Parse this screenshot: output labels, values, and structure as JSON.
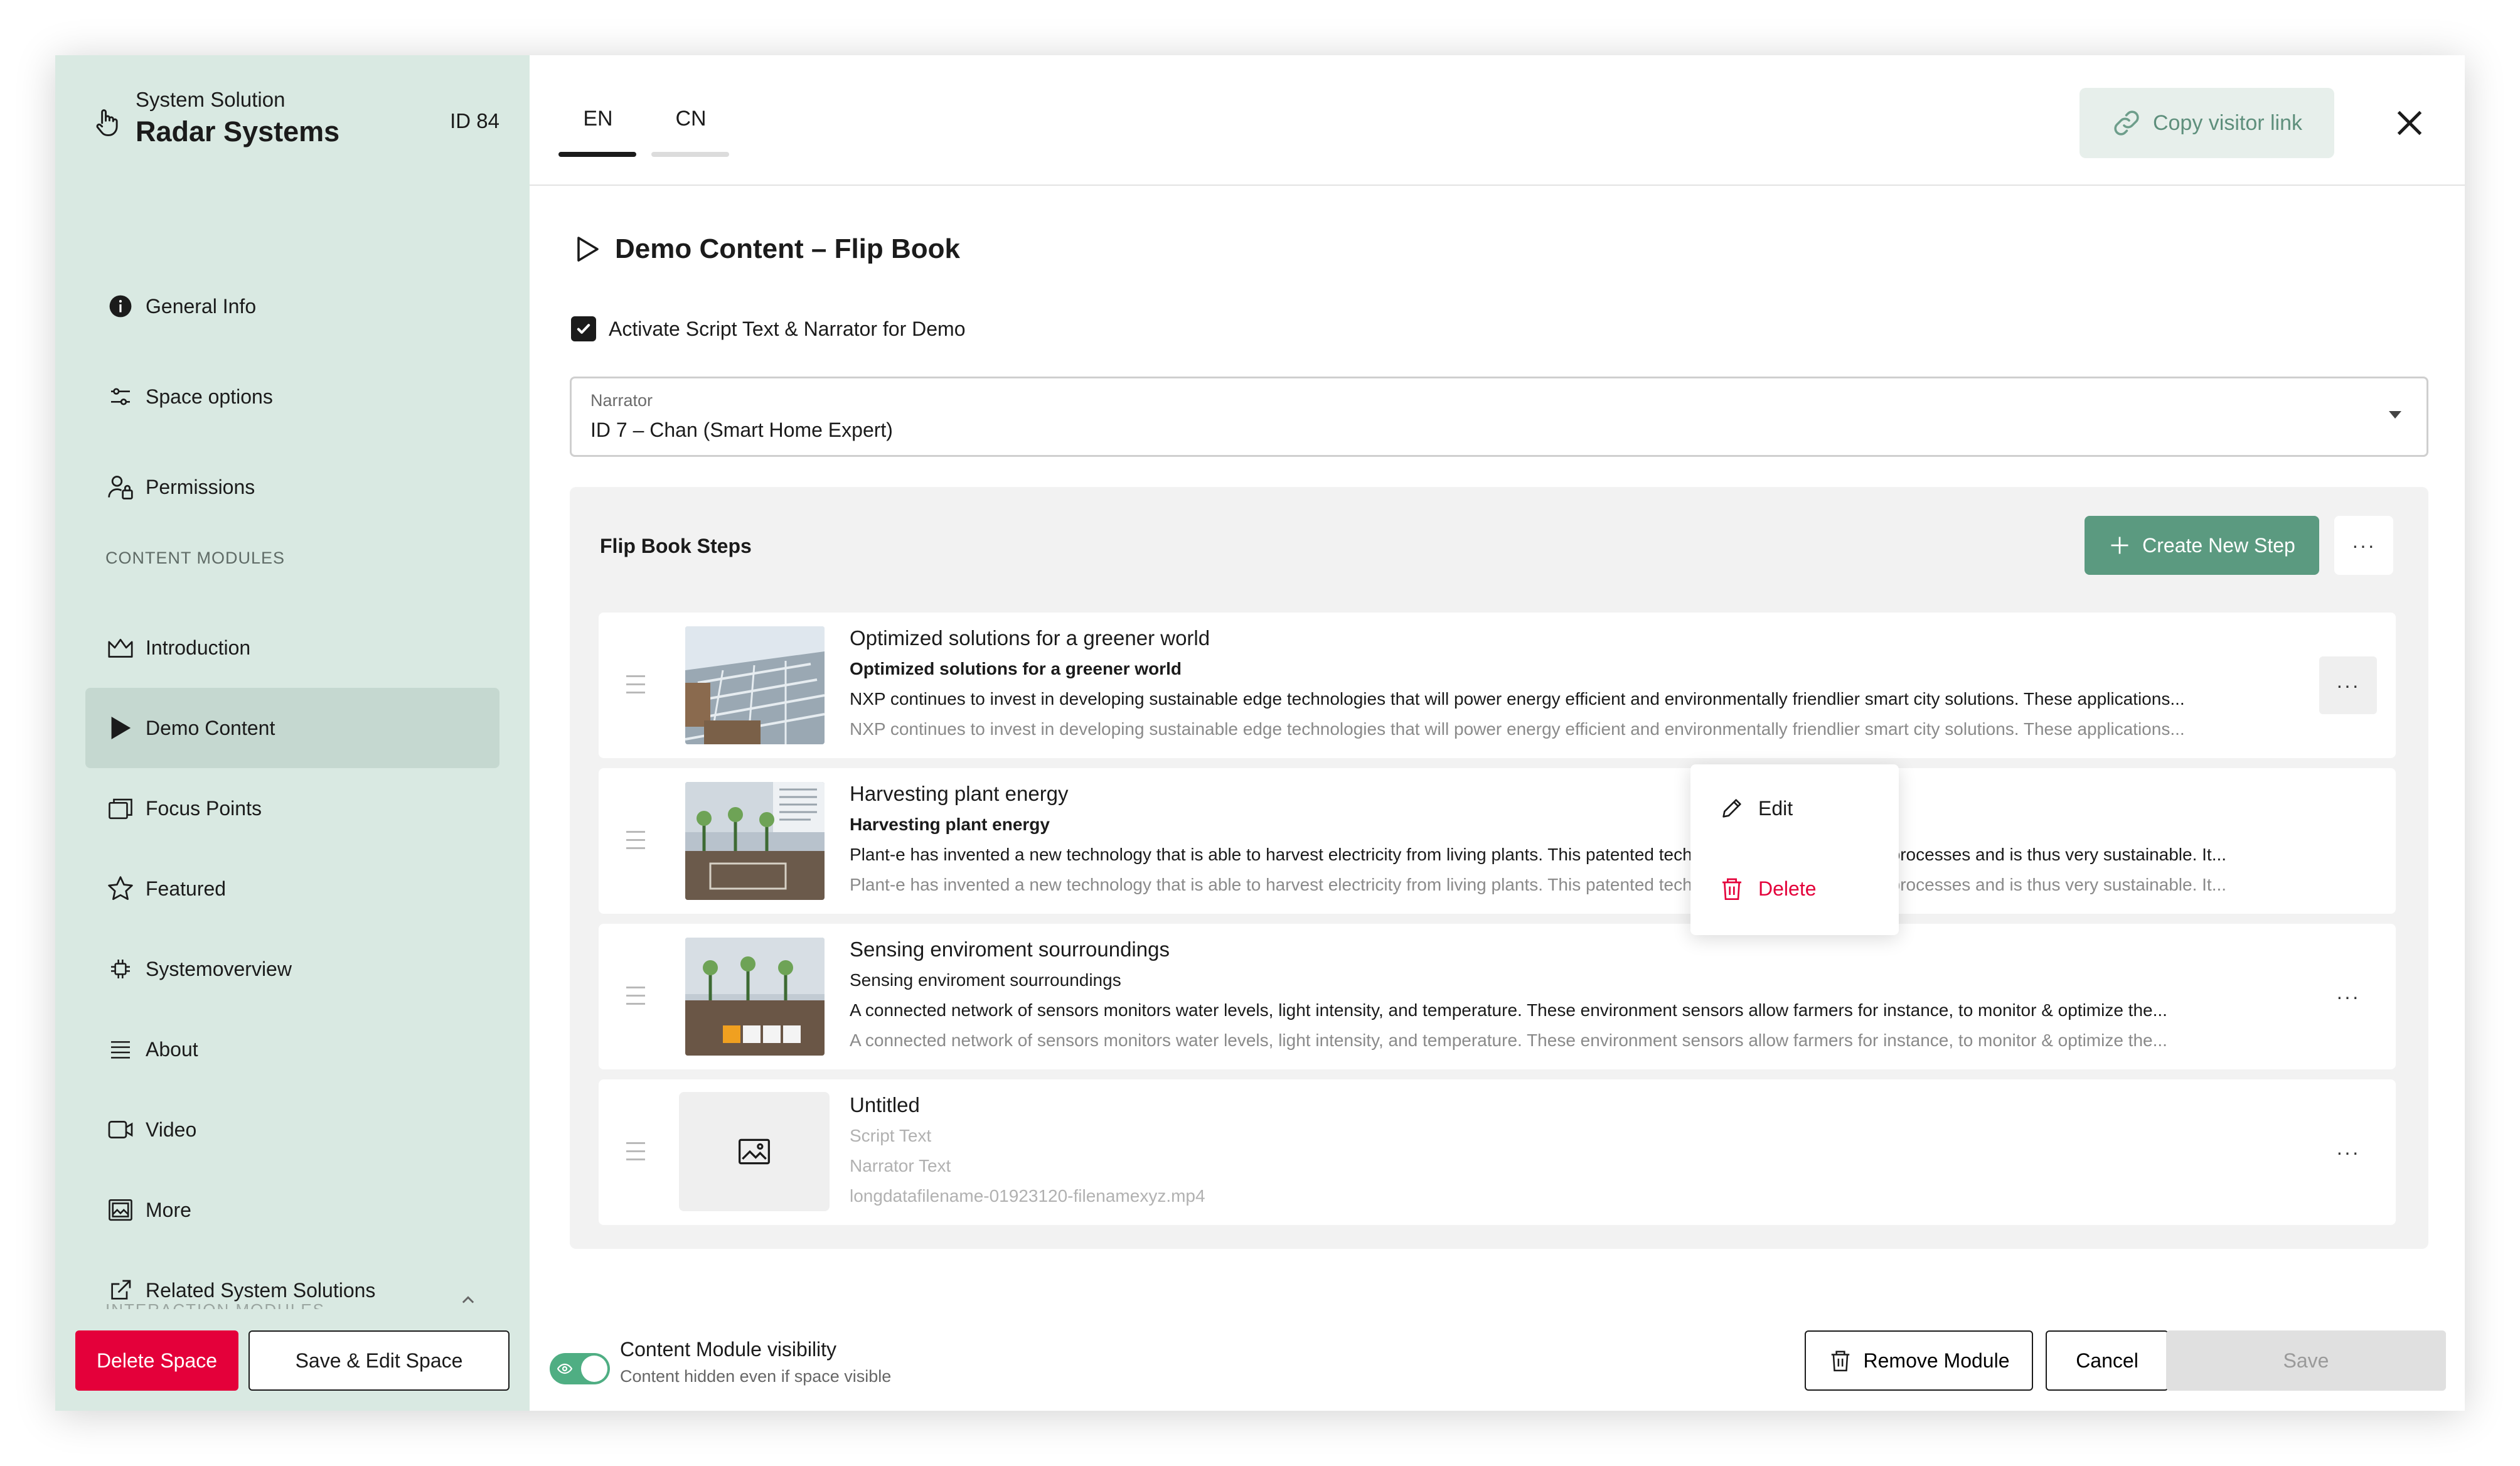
{
  "sidebar": {
    "subtitle": "System Solution",
    "title": "Radar Systems",
    "id_label": "ID 84",
    "items_top": [
      {
        "label": "General Info",
        "icon": "info-icon"
      },
      {
        "label": "Space options",
        "icon": "sliders-icon"
      },
      {
        "label": "Permissions",
        "icon": "user-lock-icon"
      }
    ],
    "section_label": "CONTENT MODULES",
    "items_content": [
      {
        "label": "Introduction",
        "icon": "crown-icon"
      },
      {
        "label": "Demo Content",
        "icon": "play-icon",
        "active": true
      },
      {
        "label": "Focus Points",
        "icon": "cards-icon"
      },
      {
        "label": "Featured",
        "icon": "star-icon"
      },
      {
        "label": "Systemoverview",
        "icon": "chip-icon"
      },
      {
        "label": "About",
        "icon": "list-icon"
      },
      {
        "label": "Video",
        "icon": "video-icon"
      },
      {
        "label": "More",
        "icon": "gallery-icon"
      },
      {
        "label": "Related System Solutions",
        "icon": "external-link-icon"
      }
    ],
    "cut_section_label": "INTERACTION MODULES",
    "delete_label": "Delete Space",
    "save_edit_label": "Save & Edit Space"
  },
  "header": {
    "tabs": [
      {
        "label": "EN",
        "active": true
      },
      {
        "label": "CN",
        "active": false
      }
    ],
    "copy_link_label": "Copy visitor link"
  },
  "content": {
    "section_title": "Demo Content – Flip Book",
    "checkbox_label": "Activate Script Text & Narrator for Demo",
    "checkbox_checked": true,
    "narrator_label": "Narrator",
    "narrator_value": "ID 7  – Chan (Smart Home Expert)",
    "steps_title": "Flip Book Steps",
    "create_step_label": "Create New Step",
    "more_label": "···",
    "steps": [
      {
        "title": "Optimized solutions for a greener world",
        "subtitle": "Optimized solutions for a greener world",
        "script": "NXP continues to invest in developing sustainable edge technologies that will power energy efficient and environmentally friendlier smart city solutions. These applications...",
        "narrator": "NXP continues to invest in developing sustainable edge technologies that will power energy efficient and environmentally friendlier smart city solutions. These applications..."
      },
      {
        "title": "Harvesting plant energy",
        "subtitle": "Harvesting plant energy",
        "script": "Plant-e has invented a new technology that is able to harvest electricity from living plants. This patented technology runs on biological processes and is thus very sustainable. It...",
        "narrator": "Plant-e has invented a new technology that is able to harvest electricity from living plants. This patented technology runs on biological processes and is thus very sustainable. It..."
      },
      {
        "title": "Sensing enviroment sourroundings",
        "subtitle": "Sensing enviroment sourroundings",
        "script": "A connected network of sensors monitors water levels, light intensity, and temperature. These environment sensors allow farmers for instance, to monitor & optimize the...",
        "narrator": "A connected network of sensors monitors water levels, light intensity, and temperature. These environment sensors allow farmers for instance, to monitor & optimize the..."
      },
      {
        "title": "Untitled",
        "subtitle": "Script Text",
        "script": "Narrator Text",
        "narrator": "longdatafilename-01923120-filenamexyz.mp4"
      }
    ],
    "dropdown": {
      "edit_label": "Edit",
      "delete_label": "Delete"
    }
  },
  "footer": {
    "visibility_title": "Content Module visibility",
    "visibility_sub": "Content hidden even if space visible",
    "visibility_on": true,
    "remove_label": "Remove Module",
    "cancel_label": "Cancel",
    "save_label": "Save"
  },
  "colors": {
    "sidebar_bg": "#d9e9e2",
    "accent_green": "#5b9a80",
    "danger": "#e4003a"
  }
}
